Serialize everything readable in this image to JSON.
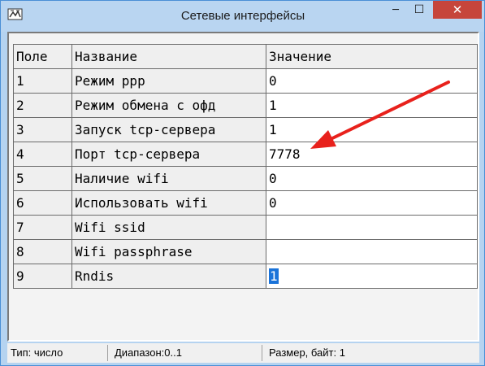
{
  "window": {
    "title": "Сетевые интерфейсы",
    "minimize_glyph": "─",
    "maximize_glyph": "☐",
    "close_glyph": "✕"
  },
  "table": {
    "headers": [
      "Поле",
      "Название",
      "Значение"
    ],
    "rows": [
      {
        "field": "1",
        "name": "Режим ppp",
        "value": "0"
      },
      {
        "field": "2",
        "name": "Режим обмена с офд",
        "value": "1"
      },
      {
        "field": "3",
        "name": "Запуск tcp-сервера",
        "value": "1"
      },
      {
        "field": "4",
        "name": "Порт tcp-сервера",
        "value": "7778"
      },
      {
        "field": "5",
        "name": "Наличие wifi",
        "value": "0"
      },
      {
        "field": "6",
        "name": "Использовать wifi",
        "value": "0"
      },
      {
        "field": "7",
        "name": "Wifi ssid",
        "value": ""
      },
      {
        "field": "8",
        "name": "Wifi passphrase",
        "value": ""
      },
      {
        "field": "9",
        "name": "Rndis",
        "value": "1"
      }
    ]
  },
  "status": {
    "type": "Тип: число",
    "range": "Диапазон:0..1",
    "size": "Размер, байт: 1"
  },
  "colors": {
    "arrow": "#e8211c",
    "selection": "#1a73d9",
    "close_button": "#c6453b",
    "title_bar": "#b9d5f1"
  }
}
